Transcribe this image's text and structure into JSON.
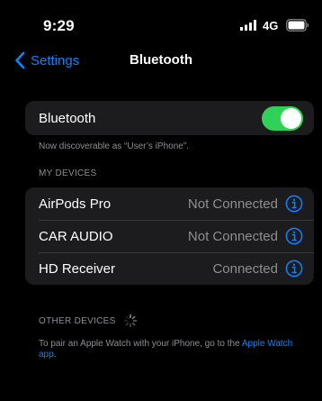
{
  "status_bar": {
    "time": "9:29",
    "network": "4G"
  },
  "nav": {
    "back_label": "Settings",
    "title": "Bluetooth"
  },
  "bluetooth_toggle": {
    "label": "Bluetooth",
    "on": true,
    "color": "#30d158"
  },
  "discoverable_note": "Now discoverable as “User’s iPhone”.",
  "my_devices": {
    "header": "MY DEVICES",
    "items": [
      {
        "name": "AirPods Pro",
        "status": "Not Connected"
      },
      {
        "name": "CAR AUDIO",
        "status": "Not Connected"
      },
      {
        "name": "HD Receiver",
        "status": "Connected"
      }
    ]
  },
  "other_devices": {
    "header": "OTHER DEVICES",
    "note_prefix": "To pair an Apple Watch with your iPhone, go to the ",
    "note_link": "Apple Watch app",
    "note_suffix": "."
  },
  "colors": {
    "accent": "#0a84ff",
    "background": "#000000",
    "group_background": "#1c1c1e",
    "secondary_text": "#8e8e93"
  },
  "icons": {
    "back": "chevron-left-icon",
    "info": "info-circle-icon",
    "signal": "cellular-signal-icon",
    "battery": "battery-icon",
    "spinner": "activity-spinner-icon"
  }
}
